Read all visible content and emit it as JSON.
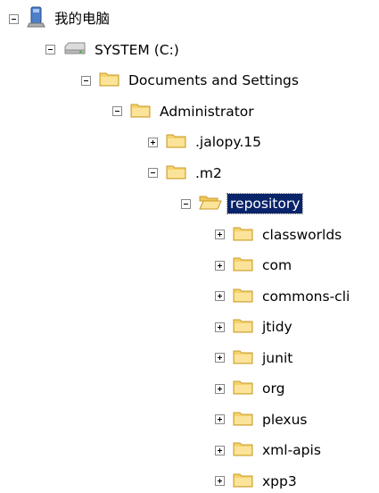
{
  "tree": {
    "nodes": [
      {
        "label": "我的电脑",
        "level": 0,
        "icon": "computer-icon",
        "expanded": true,
        "selected": false
      },
      {
        "label": "SYSTEM (C:)",
        "level": 1,
        "icon": "drive-icon",
        "expanded": true,
        "selected": false
      },
      {
        "label": "Documents and Settings",
        "level": 2,
        "icon": "folder-icon",
        "expanded": true,
        "selected": false
      },
      {
        "label": "Administrator",
        "level": 3,
        "icon": "folder-icon",
        "expanded": true,
        "selected": false
      },
      {
        "label": ".jalopy.15",
        "level": 4,
        "icon": "folder-icon",
        "expanded": false,
        "selected": false
      },
      {
        "label": ".m2",
        "level": 4,
        "icon": "folder-icon",
        "expanded": true,
        "selected": false
      },
      {
        "label": "repository",
        "level": 5,
        "icon": "folder-open-icon",
        "expanded": true,
        "selected": true
      },
      {
        "label": "classworlds",
        "level": 6,
        "icon": "folder-icon",
        "expanded": false,
        "selected": false
      },
      {
        "label": "com",
        "level": 6,
        "icon": "folder-icon",
        "expanded": false,
        "selected": false
      },
      {
        "label": "commons-cli",
        "level": 6,
        "icon": "folder-icon",
        "expanded": false,
        "selected": false
      },
      {
        "label": "jtidy",
        "level": 6,
        "icon": "folder-icon",
        "expanded": false,
        "selected": false
      },
      {
        "label": "junit",
        "level": 6,
        "icon": "folder-icon",
        "expanded": false,
        "selected": false
      },
      {
        "label": "org",
        "level": 6,
        "icon": "folder-icon",
        "expanded": false,
        "selected": false
      },
      {
        "label": "plexus",
        "level": 6,
        "icon": "folder-icon",
        "expanded": false,
        "selected": false
      },
      {
        "label": "xml-apis",
        "level": 6,
        "icon": "folder-icon",
        "expanded": false,
        "selected": false
      },
      {
        "label": "xpp3",
        "level": 6,
        "icon": "folder-icon",
        "expanded": false,
        "selected": false
      }
    ]
  },
  "colors": {
    "selection_background": "#0a246a",
    "selection_text": "#ffffff",
    "folder_fill": "#f5d36b",
    "folder_edge": "#c89b2a"
  }
}
